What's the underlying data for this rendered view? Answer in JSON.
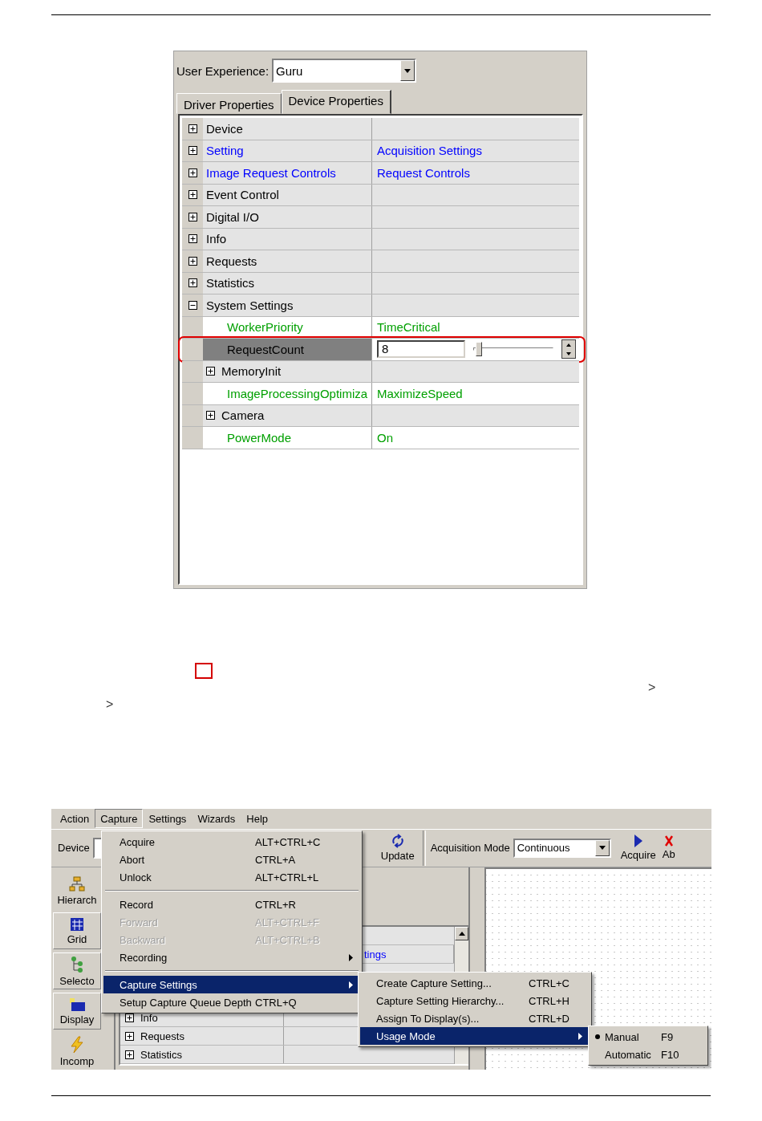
{
  "figure1": {
    "user_experience": {
      "label": "User Experience:",
      "value": "Guru"
    },
    "tabs": [
      {
        "label": "Driver Properties",
        "selected": false
      },
      {
        "label": "Device Properties",
        "selected": true
      }
    ],
    "rows": [
      {
        "name": "Device",
        "kind": "group",
        "expanded": false,
        "selected": false,
        "color": "#000000"
      },
      {
        "name": "Setting",
        "value": "Acquisition Settings",
        "kind": "group",
        "expanded": false,
        "selected": false,
        "color": "#0000ff"
      },
      {
        "name": "Image Request Controls",
        "value": "Request Controls",
        "kind": "group",
        "expanded": false,
        "selected": false,
        "color": "#0000ff"
      },
      {
        "name": "Event Control",
        "kind": "group",
        "expanded": false,
        "selected": false,
        "color": "#000000"
      },
      {
        "name": "Digital I/O",
        "kind": "group",
        "expanded": false,
        "selected": false,
        "color": "#000000"
      },
      {
        "name": "Info",
        "kind": "group",
        "expanded": false,
        "selected": false,
        "color": "#000000"
      },
      {
        "name": "Requests",
        "kind": "group",
        "expanded": false,
        "selected": false,
        "color": "#000000"
      },
      {
        "name": "Statistics",
        "kind": "group",
        "expanded": false,
        "selected": false,
        "color": "#000000"
      },
      {
        "name": "System Settings",
        "kind": "group",
        "expanded": true,
        "selected": false,
        "color": "#000000",
        "children": [
          {
            "name": "WorkerPriority",
            "value": "TimeCritical",
            "kind": "property",
            "selected": false,
            "color": "#00a000"
          },
          {
            "name": "RequestCount",
            "value": "8",
            "kind": "slider",
            "level": 0.03,
            "selected": true,
            "color": "#000000"
          },
          {
            "name": "MemoryInit",
            "kind": "group",
            "expanded": false,
            "selected": false,
            "color": "#000000"
          },
          {
            "name": "ImageProcessingOptimiza",
            "value": "MaximizeSpeed",
            "kind": "property",
            "selected": false,
            "color": "#00a000"
          },
          {
            "name": "Camera",
            "kind": "group",
            "expanded": false,
            "selected": false,
            "color": "#000000"
          },
          {
            "name": "PowerMode",
            "value": "On",
            "kind": "property",
            "selected": false,
            "color": "#00a000"
          }
        ]
      }
    ]
  },
  "body_marks": [
    ">",
    ">"
  ],
  "figure2": {
    "menubar": [
      {
        "label": "Action",
        "selected": false
      },
      {
        "label": "Capture",
        "selected": true
      },
      {
        "label": "Settings",
        "selected": false
      },
      {
        "label": "Wizards",
        "selected": false
      },
      {
        "label": "Help",
        "selected": false
      }
    ],
    "toolbar": {
      "device_label": "Device",
      "update": "Update",
      "acquisition_mode_label": "Acquisition Mode",
      "acquisition_mode": "Continuous",
      "acquire": "Acquire",
      "abort": "Ab"
    },
    "sidebar": [
      {
        "label": "Hierarch",
        "kind": "hierarchy"
      },
      {
        "label": "Grid",
        "kind": "grid"
      },
      {
        "label": "Selecto",
        "kind": "selector"
      },
      {
        "label": "Display",
        "kind": "display"
      },
      {
        "label": "Incomp",
        "kind": "incomplete"
      }
    ],
    "grid": {
      "visible_value": "tings",
      "rows": [
        {
          "name": "Info",
          "expanded": false
        },
        {
          "name": "Requests",
          "expanded": false
        },
        {
          "name": "Statistics",
          "expanded": false
        }
      ]
    },
    "capture_menu": [
      {
        "kind": "item",
        "label": "Acquire",
        "shortcut": "ALT+CTRL+C",
        "disabled": false,
        "selected": false,
        "submenu": false
      },
      {
        "kind": "item",
        "label": "Abort",
        "shortcut": "CTRL+A",
        "disabled": false,
        "selected": false,
        "submenu": false
      },
      {
        "kind": "item",
        "label": "Unlock",
        "shortcut": "ALT+CTRL+L",
        "disabled": false,
        "selected": false,
        "submenu": false
      },
      {
        "kind": "separator"
      },
      {
        "kind": "item",
        "label": "Record",
        "shortcut": "CTRL+R",
        "disabled": false,
        "selected": false,
        "submenu": false
      },
      {
        "kind": "item",
        "label": "Forward",
        "shortcut": "ALT+CTRL+F",
        "disabled": true,
        "selected": false,
        "submenu": false
      },
      {
        "kind": "item",
        "label": "Backward",
        "shortcut": "ALT+CTRL+B",
        "disabled": true,
        "selected": false,
        "submenu": false
      },
      {
        "kind": "item",
        "label": "Recording",
        "disabled": false,
        "selected": false,
        "submenu": true
      },
      {
        "kind": "separator"
      },
      {
        "kind": "item",
        "label": "Capture Settings",
        "disabled": false,
        "selected": true,
        "submenu": true
      },
      {
        "kind": "item",
        "label": "Setup Capture Queue Depth",
        "shortcut": "CTRL+Q",
        "disabled": false,
        "selected": false,
        "submenu": false
      }
    ],
    "capture_settings_menu": [
      {
        "kind": "item",
        "label": "Create Capture Setting...",
        "shortcut": "CTRL+C",
        "disabled": false,
        "selected": false,
        "submenu": false
      },
      {
        "kind": "item",
        "label": "Capture Setting Hierarchy...",
        "shortcut": "CTRL+H",
        "disabled": false,
        "selected": false,
        "submenu": false
      },
      {
        "kind": "item",
        "label": "Assign To Display(s)...",
        "shortcut": "CTRL+D",
        "disabled": false,
        "selected": false,
        "submenu": false
      },
      {
        "kind": "item",
        "label": "Usage Mode",
        "disabled": false,
        "selected": true,
        "submenu": true
      }
    ],
    "usage_mode_menu": [
      {
        "label": "Manual",
        "shortcut": "F9",
        "checked": true
      },
      {
        "label": "Automatic",
        "shortcut": "F10",
        "checked": false
      }
    ]
  }
}
